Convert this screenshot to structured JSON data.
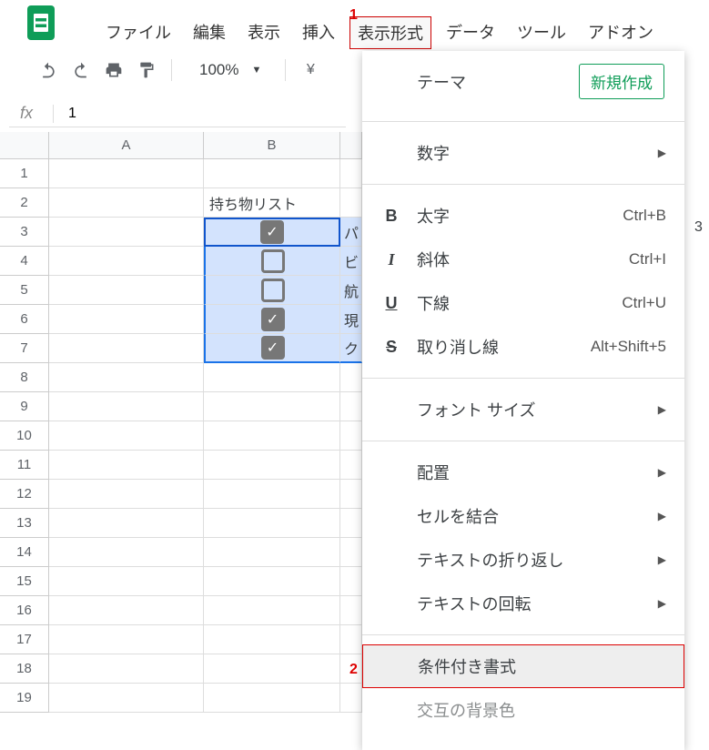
{
  "menubar": {
    "file": "ファイル",
    "edit": "編集",
    "view": "表示",
    "insert": "挿入",
    "format": "表示形式",
    "data": "データ",
    "tools": "ツール",
    "addons": "アドオン"
  },
  "annotations": {
    "one": "1",
    "two": "2"
  },
  "toolbar": {
    "zoom": "100%",
    "currency": "¥"
  },
  "formula_bar": {
    "label": "fx",
    "value": "1"
  },
  "columns": {
    "A": "A",
    "B": "B"
  },
  "rows": [
    "1",
    "2",
    "3",
    "4",
    "5",
    "6",
    "7",
    "8",
    "9",
    "10",
    "11",
    "12",
    "13",
    "14",
    "15",
    "16",
    "17",
    "18",
    "19"
  ],
  "cells": {
    "B2": "持ち物リスト",
    "B3_checked": true,
    "B4_checked": false,
    "B5_checked": false,
    "B6_checked": true,
    "B7_checked": true,
    "C3": "パ",
    "C4": "ビ",
    "C5": "航",
    "C6": "現",
    "C7": "ク",
    "right_3": "3"
  },
  "dropdown": {
    "theme": "テーマ",
    "new_btn": "新規作成",
    "number": "数字",
    "bold": "太字",
    "bold_sc": "Ctrl+B",
    "italic": "斜体",
    "italic_sc": "Ctrl+I",
    "underline": "下線",
    "underline_sc": "Ctrl+U",
    "strike": "取り消し線",
    "strike_sc": "Alt+Shift+5",
    "fontsize": "フォント サイズ",
    "align": "配置",
    "merge": "セルを結合",
    "wrap": "テキストの折り返し",
    "rotate": "テキストの回転",
    "conditional": "条件付き書式",
    "altcolors": "交互の背景色"
  }
}
